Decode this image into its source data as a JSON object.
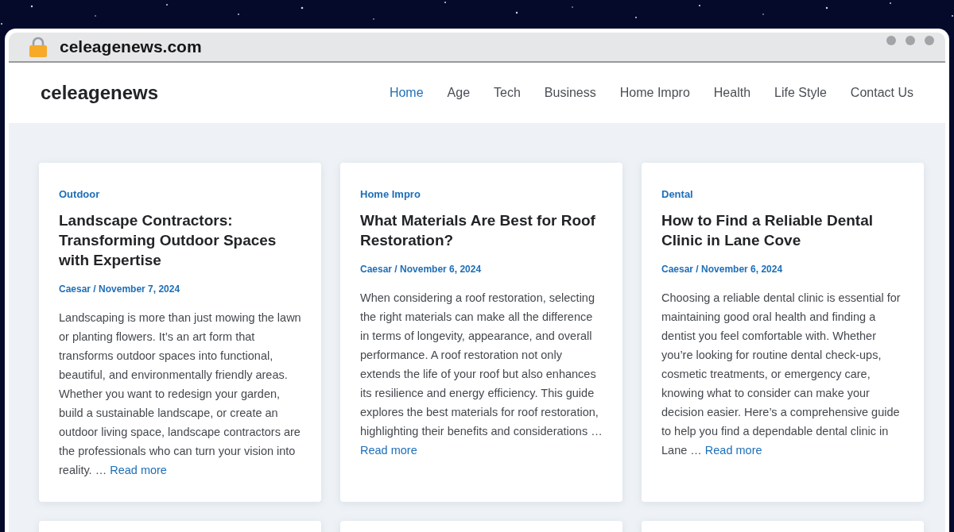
{
  "browser": {
    "url": "celeagenews.com"
  },
  "site": {
    "logo": "celeagenews",
    "nav": [
      {
        "label": "Home",
        "selected": true
      },
      {
        "label": "Age",
        "selected": false
      },
      {
        "label": "Tech",
        "selected": false
      },
      {
        "label": "Business",
        "selected": false
      },
      {
        "label": "Home Impro",
        "selected": false
      },
      {
        "label": "Health",
        "selected": false
      },
      {
        "label": "Life Style",
        "selected": false
      },
      {
        "label": "Contact Us",
        "selected": false
      }
    ]
  },
  "posts": [
    {
      "kind": "full",
      "category": "Outdoor",
      "title": "Landscape Contractors: Transforming Outdoor Spaces with Expertise",
      "meta": "Caesar / November 7, 2024",
      "excerpt": "Landscaping is more than just mowing the lawn or planting flowers. It’s an art form that transforms outdoor spaces into functional, beautiful, and environmentally friendly areas. Whether you want to redesign your garden, build a sustainable landscape, or create an outdoor living space, landscape contractors are the professionals who can turn your vision into reality. …",
      "read_more": "Read more"
    },
    {
      "kind": "full",
      "category": "Home Impro",
      "title": "What Materials Are Best for Roof Restoration?",
      "meta": "Caesar / November 6, 2024",
      "excerpt": "When considering a roof restoration, selecting the right materials can make all the difference in terms of longevity, appearance, and overall performance. A roof restoration not only extends the life of your roof but also enhances its resilience and energy efficiency. This guide explores the best materials for roof restoration, highlighting their benefits and considerations …",
      "read_more": "Read more"
    },
    {
      "kind": "full",
      "category": "Dental",
      "title": "How to Find a Reliable Dental Clinic in Lane Cove",
      "meta": "Caesar / November 6, 2024",
      "excerpt": "Choosing a reliable dental clinic is essential for maintaining good oral health and finding a dentist you feel comfortable with. Whether you’re looking for routine dental check-ups, cosmetic treatments, or emergency care, knowing what to consider can make your decision easier. Here’s a comprehensive guide to help you find a dependable dental clinic in Lane …",
      "read_more": "Read more"
    },
    {
      "kind": "cut_off"
    },
    {
      "kind": "cut_off"
    },
    {
      "kind": "cut_off"
    }
  ]
}
